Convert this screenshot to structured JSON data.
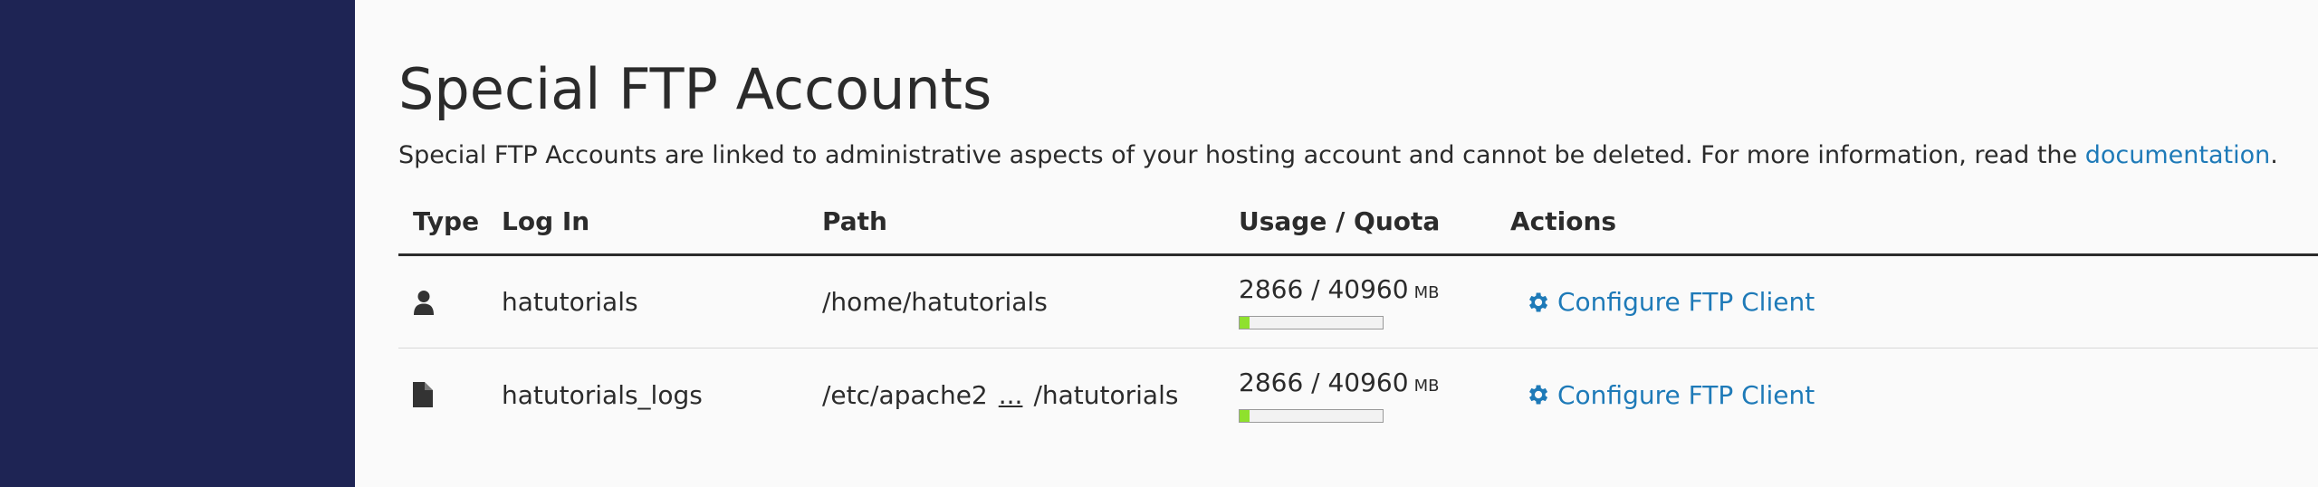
{
  "header": {
    "title": "Special FTP Accounts",
    "description_prefix": "Special FTP Accounts are linked to administrative aspects of your hosting account and cannot be deleted. For more information, read the ",
    "documentation_link": "documentation",
    "description_suffix": "."
  },
  "table": {
    "columns": [
      "Type",
      "Log In",
      "Path",
      "Usage / Quota",
      "Actions"
    ],
    "rows": [
      {
        "type_icon": "user-icon",
        "login": "hatutorials",
        "path_start": "/home/hatutorials",
        "path_ellipsis": "",
        "path_end": "",
        "usage": "2866 / 40960",
        "unit": "MB",
        "usage_fraction": 0.07,
        "action_label": "Configure FTP Client"
      },
      {
        "type_icon": "file-icon",
        "login": "hatutorials_logs",
        "path_start": "/etc/apache2",
        "path_ellipsis": "...",
        "path_end": "/hatutorials",
        "usage": "2866 / 40960",
        "unit": "MB",
        "usage_fraction": 0.07,
        "action_label": "Configure FTP Client"
      }
    ]
  },
  "colors": {
    "sidebar": "#1e2454",
    "link": "#1e7ab8",
    "bar_fill": "#8fe12d"
  }
}
